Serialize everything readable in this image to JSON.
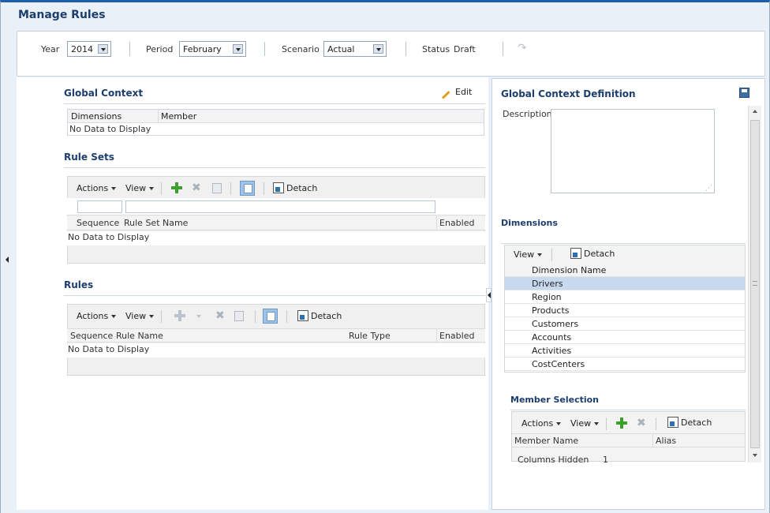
{
  "page": {
    "title": "Manage Rules"
  },
  "pov": {
    "year_label": "Year",
    "year_value": "2014",
    "period_label": "Period",
    "period_value": "February",
    "scenario_label": "Scenario",
    "scenario_value": "Actual",
    "status_label": "Status",
    "status_value": "Draft"
  },
  "global_context": {
    "title": "Global Context",
    "edit_label": "Edit",
    "columns": [
      "Dimensions",
      "Member"
    ],
    "empty_text": "No Data to Display"
  },
  "rule_sets": {
    "title": "Rule Sets",
    "actions_label": "Actions",
    "view_label": "View",
    "detach_label": "Detach",
    "columns": [
      "Sequence",
      "Rule Set Name",
      "Enabled"
    ],
    "empty_text": "No Data to Display"
  },
  "rules": {
    "title": "Rules",
    "actions_label": "Actions",
    "view_label": "View",
    "detach_label": "Detach",
    "columns": [
      "Sequence",
      "Rule Name",
      "Rule Type",
      "Enabled"
    ],
    "empty_text": "No Data to Display"
  },
  "definition": {
    "title": "Global Context Definition",
    "description_label": "Description",
    "description_value": ""
  },
  "dimensions": {
    "title": "Dimensions",
    "view_label": "View",
    "detach_label": "Detach",
    "column": "Dimension Name",
    "rows": [
      "Drivers",
      "Region",
      "Products",
      "Customers",
      "Accounts",
      "Activities",
      "CostCenters"
    ],
    "selected_index": 0
  },
  "member_selection": {
    "title": "Member Selection",
    "actions_label": "Actions",
    "view_label": "View",
    "detach_label": "Detach",
    "columns": [
      "Member Name",
      "Alias"
    ],
    "columns_hidden_label": "Columns Hidden",
    "columns_hidden_value": "1"
  },
  "colors": {
    "title_blue": "#1c3e6e",
    "selected_row": "#c7d9ee",
    "add_green": "#3ca02c"
  },
  "icons": [
    "dropdown-arrow-icon",
    "forward-arrow-icon",
    "pencil-icon",
    "add-icon",
    "delete-icon",
    "copy-icon",
    "query-by-example-icon",
    "detach-icon",
    "save-icon",
    "splitter-arrow-icon"
  ]
}
